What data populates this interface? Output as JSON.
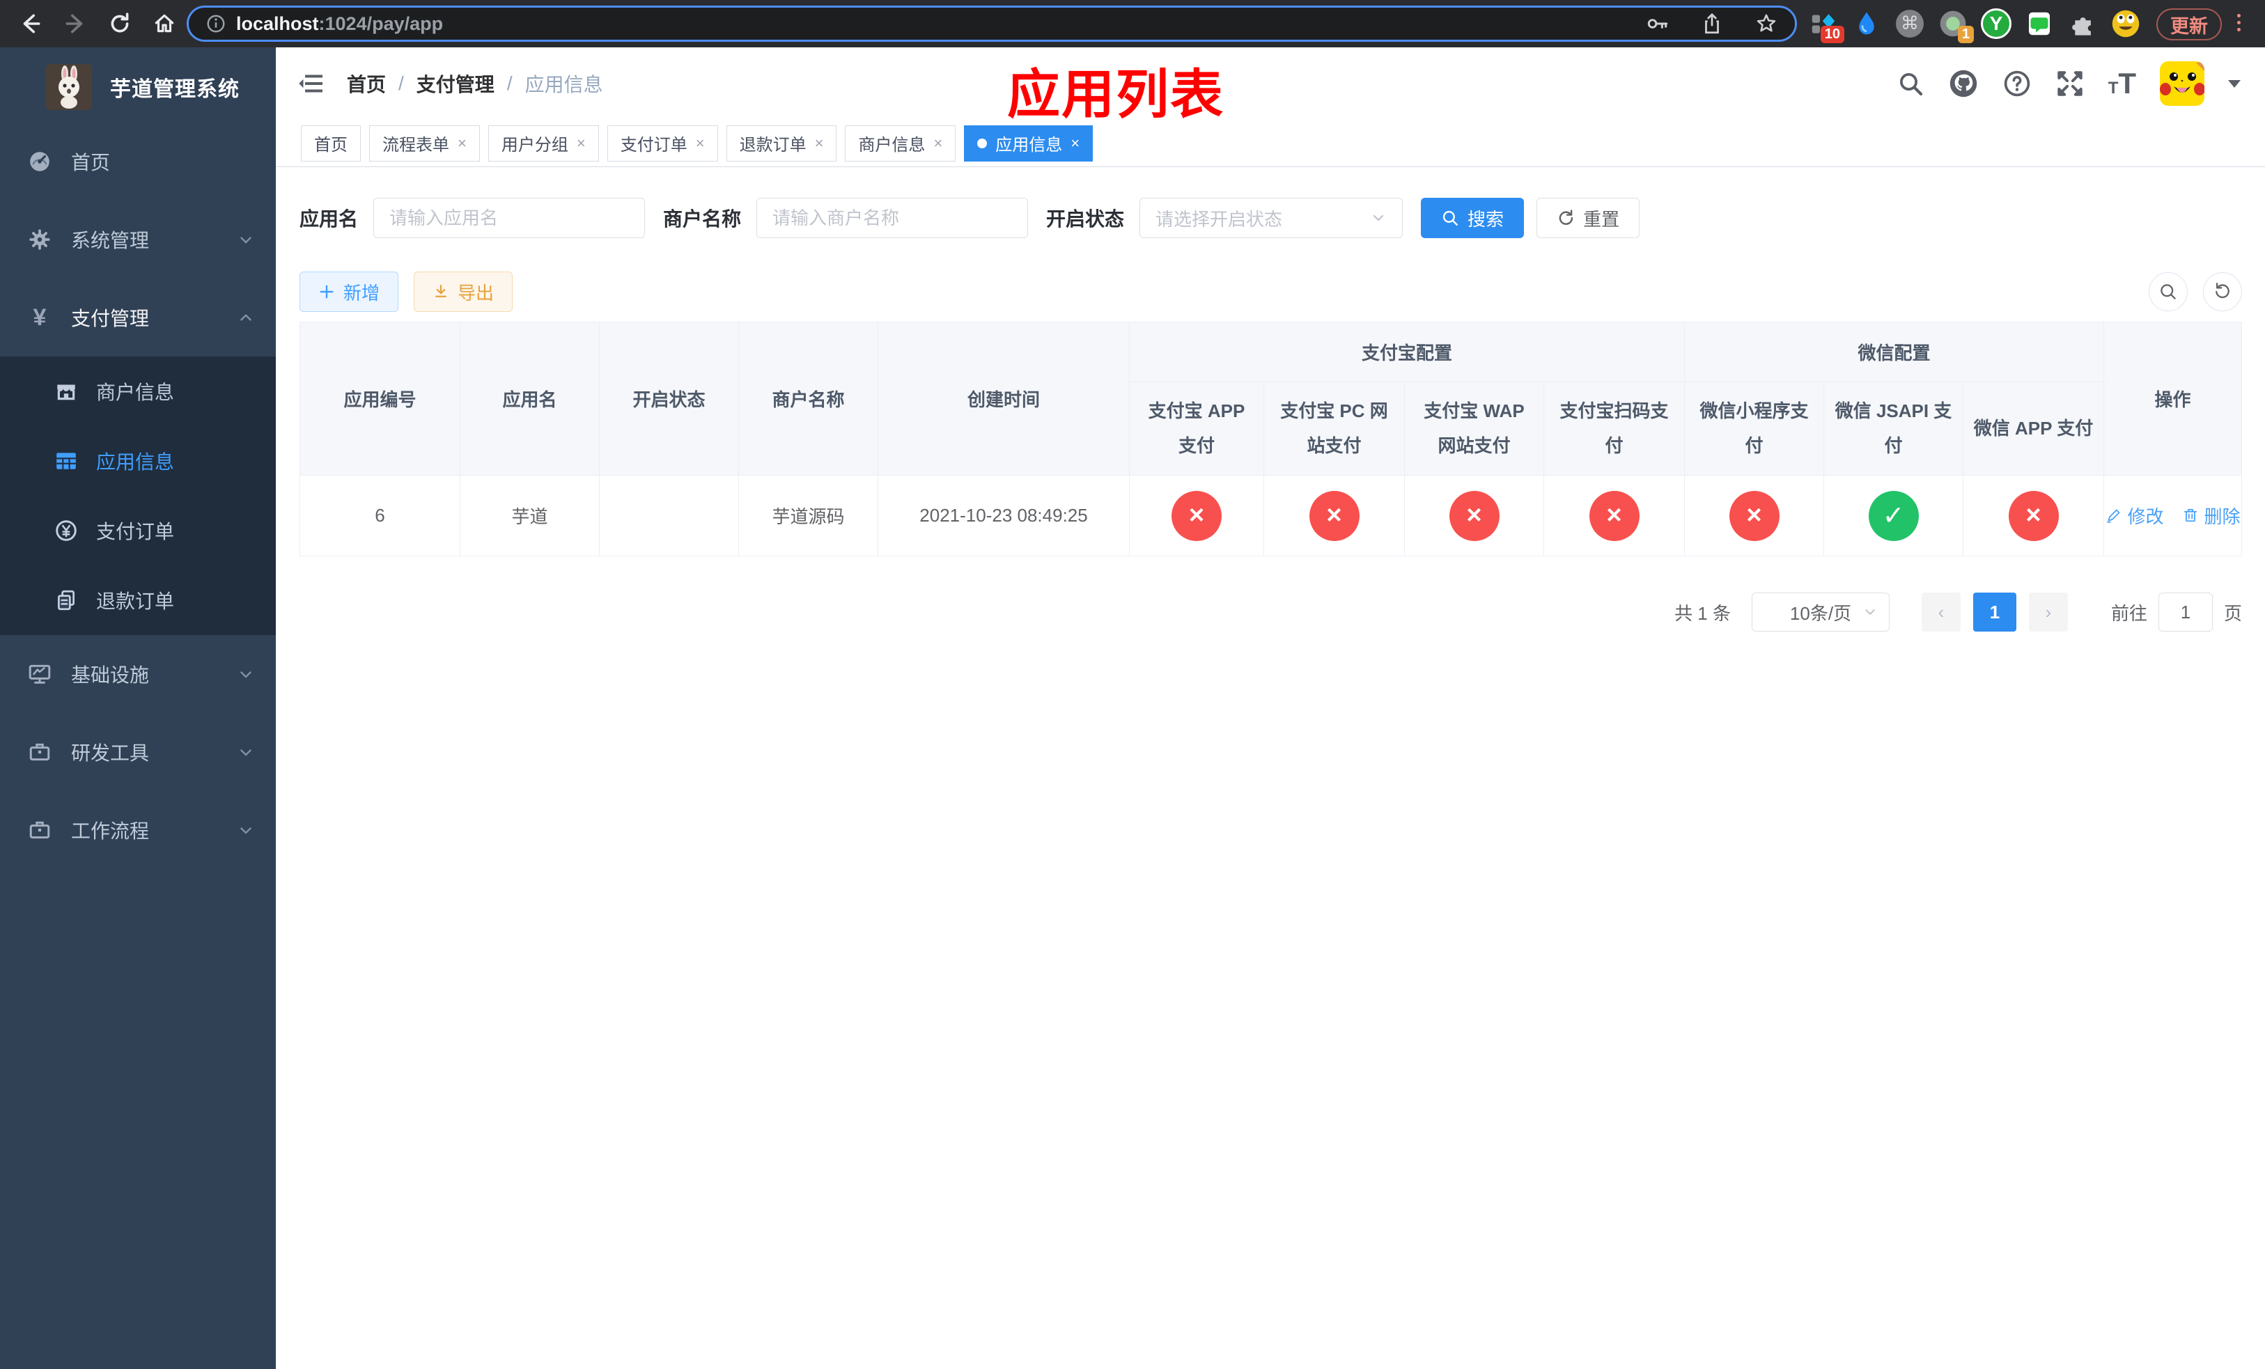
{
  "browser": {
    "url_host": "localhost",
    "url_rest": ":1024/pay/app",
    "update_label": "更新",
    "ext_badge_translate": "10",
    "ext_badge_record": "1",
    "ext_y_label": "Y"
  },
  "icons": {
    "cmd": "⌘",
    "close": "×",
    "breadcrumb_sep": "/",
    "pass": "✓",
    "fail": "×",
    "prev": "‹",
    "next": "›",
    "font_small": "T",
    "font_big": "T"
  },
  "sidebar": {
    "title": "芋道管理系统",
    "items": [
      {
        "label": "首页"
      },
      {
        "label": "系统管理"
      },
      {
        "label": "支付管理"
      },
      {
        "label": "基础设施"
      },
      {
        "label": "研发工具"
      },
      {
        "label": "工作流程"
      }
    ],
    "submenu": [
      {
        "label": "商户信息"
      },
      {
        "label": "应用信息"
      },
      {
        "label": "支付订单"
      },
      {
        "label": "退款订单"
      }
    ],
    "yen_glyph": "¥"
  },
  "header": {
    "breadcrumb": [
      "首页",
      "支付管理",
      "应用信息"
    ],
    "overlay_title": "应用列表"
  },
  "tabs": [
    {
      "label": "首页"
    },
    {
      "label": "流程表单"
    },
    {
      "label": "用户分组"
    },
    {
      "label": "支付订单"
    },
    {
      "label": "退款订单"
    },
    {
      "label": "商户信息"
    },
    {
      "label": "应用信息"
    }
  ],
  "filters": {
    "app_name_label": "应用名",
    "app_name_placeholder": "请输入应用名",
    "merchant_label": "商户名称",
    "merchant_placeholder": "请输入商户名称",
    "status_label": "开启状态",
    "status_placeholder": "请选择开启状态",
    "search_label": "搜索",
    "reset_label": "重置"
  },
  "toolbar": {
    "add_label": "新增",
    "export_label": "导出"
  },
  "table": {
    "groups": {
      "alipay": "支付宝配置",
      "wechat": "微信配置"
    },
    "columns": [
      "应用编号",
      "应用名",
      "开启状态",
      "商户名称",
      "创建时间",
      "支付宝 APP 支付",
      "支付宝 PC 网站支付",
      "支付宝 WAP 网站支付",
      "支付宝扫码支付",
      "微信小程序支付",
      "微信 JSAPI 支付",
      "微信 APP 支付",
      "操作"
    ],
    "row": {
      "id": "6",
      "name": "芋道",
      "enabled": true,
      "merchant": "芋道源码",
      "created": "2021-10-23 08:49:25",
      "statuses": [
        false,
        false,
        false,
        false,
        false,
        true,
        false
      ],
      "edit_label": "修改",
      "delete_label": "删除"
    }
  },
  "pagination": {
    "total_label": "共 1 条",
    "page_size": "10条/页",
    "current_page": "1",
    "goto_label": "前往",
    "goto_value": "1",
    "page_label": "页"
  },
  "colors": {
    "primary": "#2d8cf0",
    "link_blue": "#4aa0f8",
    "menu_active": "#409eff",
    "sidebar_bg": "#304156",
    "submenu_bg": "#1f2d3d",
    "status_fail": "#f8504e",
    "status_ok": "#22c268",
    "annotation_red": "#ff0000"
  }
}
